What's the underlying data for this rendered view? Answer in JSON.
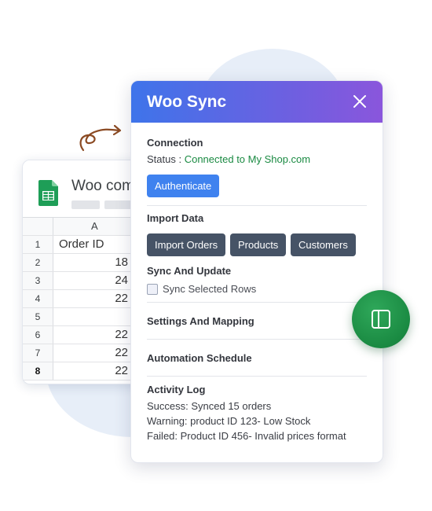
{
  "sheet": {
    "title": "Woo com",
    "column_header": "A",
    "rows": [
      {
        "num": "1",
        "value": "Order ID"
      },
      {
        "num": "2",
        "value": "18"
      },
      {
        "num": "3",
        "value": "24"
      },
      {
        "num": "4",
        "value": "22"
      },
      {
        "num": "5",
        "value": ""
      },
      {
        "num": "6",
        "value": "22"
      },
      {
        "num": "7",
        "value": "22"
      },
      {
        "num": "8",
        "value": "22"
      }
    ]
  },
  "panel": {
    "title": "Woo Sync",
    "connection": {
      "title": "Connection",
      "status_label": "Status :",
      "status_value": "Connected to My Shop.com",
      "authenticate_label": "Authenticate"
    },
    "import": {
      "title": "Import Data",
      "buttons": [
        "Import Orders",
        "Products",
        "Customers"
      ]
    },
    "sync": {
      "title": "Sync And Update",
      "checkbox_label": "Sync Selected Rows",
      "checked": false
    },
    "settings_title": "Settings And Mapping",
    "automation_title": "Automation Schedule",
    "activity": {
      "title": "Activity Log",
      "entries": [
        "Success: Synced 15 orders",
        "Warning: product ID 123- Low Stock",
        "Failed: Product ID 456- Invalid prices format"
      ]
    }
  },
  "icons": {
    "close": "close-icon",
    "sheets": "google-sheets-icon",
    "arrow": "curly-arrow-icon",
    "toggle": "sidebar-panel-icon"
  },
  "colors": {
    "header_gradient_start": "#3e74ea",
    "header_gradient_end": "#8a56dc",
    "primary_button": "#3f82ef",
    "dark_button": "#465366",
    "status_ok": "#1a8a42",
    "fab": "#1a8a42"
  }
}
